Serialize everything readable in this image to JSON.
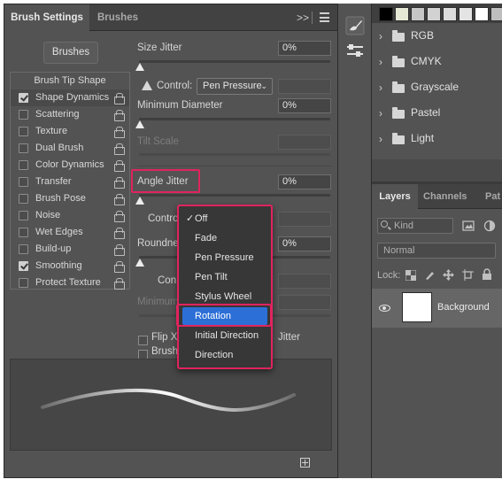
{
  "brush_panel": {
    "tabs": [
      "Brush Settings",
      "Brushes"
    ],
    "menu_glyph": ">>",
    "brushes_button": "Brushes",
    "options": [
      {
        "label": "Brush Tip Shape",
        "checked": null,
        "lock": false,
        "header": true
      },
      {
        "label": "Shape Dynamics",
        "checked": true,
        "lock": true,
        "selected": true
      },
      {
        "label": "Scattering",
        "checked": false,
        "lock": true
      },
      {
        "label": "Texture",
        "checked": false,
        "lock": true
      },
      {
        "label": "Dual Brush",
        "checked": false,
        "lock": true
      },
      {
        "label": "Color Dynamics",
        "checked": false,
        "lock": true
      },
      {
        "label": "Transfer",
        "checked": false,
        "lock": true
      },
      {
        "label": "Brush Pose",
        "checked": false,
        "lock": true
      },
      {
        "label": "Noise",
        "checked": false,
        "lock": true
      },
      {
        "label": "Wet Edges",
        "checked": false,
        "lock": true
      },
      {
        "label": "Build-up",
        "checked": false,
        "lock": true
      },
      {
        "label": "Smoothing",
        "checked": true,
        "lock": true
      },
      {
        "label": "Protect Texture",
        "checked": false,
        "lock": true
      }
    ],
    "size_jitter": {
      "label": "Size Jitter",
      "value": "0%"
    },
    "control1": {
      "label": "Control:",
      "value": "Pen Pressure"
    },
    "min_diameter": {
      "label": "Minimum Diameter",
      "value": "0%"
    },
    "tilt_scale": {
      "label": "Tilt Scale"
    },
    "angle_jitter": {
      "label": "Angle Jitter",
      "value": "0%"
    },
    "control2": {
      "label_visible": "Contro"
    },
    "roundness": {
      "label_visible": "Roundne",
      "value": "0%"
    },
    "control3": {
      "label_visible": "Con"
    },
    "min_roundness": {
      "label_visible": "Minimum"
    },
    "flip_x": {
      "label_visible": "Flip X",
      "suffix_visible": "Jitter"
    },
    "brush_projection": {
      "label_visible": "Brush"
    },
    "dropdown": {
      "items": [
        "Off",
        "Fade",
        "Pen Pressure",
        "Pen Tilt",
        "Stylus Wheel",
        "Rotation",
        "Initial Direction",
        "Direction"
      ],
      "checked": "Off",
      "active": "Rotation"
    }
  },
  "right_panel": {
    "swatch_colors": [
      "#000000",
      "#e6e8d6",
      "#c6c6c6",
      "#d2d2d2",
      "#dcdcdc",
      "#e4e4e4",
      "#ffffff",
      "#bfbfbf"
    ],
    "groups": [
      "RGB",
      "CMYK",
      "Grayscale",
      "Pastel",
      "Light"
    ]
  },
  "layers": {
    "tabs": [
      "Layers",
      "Channels",
      "Pat"
    ],
    "kind": "Kind",
    "blend_mode": "Normal",
    "lock_label": "Lock:",
    "layer_name": "Background"
  },
  "colors": {
    "highlight": "#e0245e",
    "menu_active": "#2c6fd6"
  }
}
